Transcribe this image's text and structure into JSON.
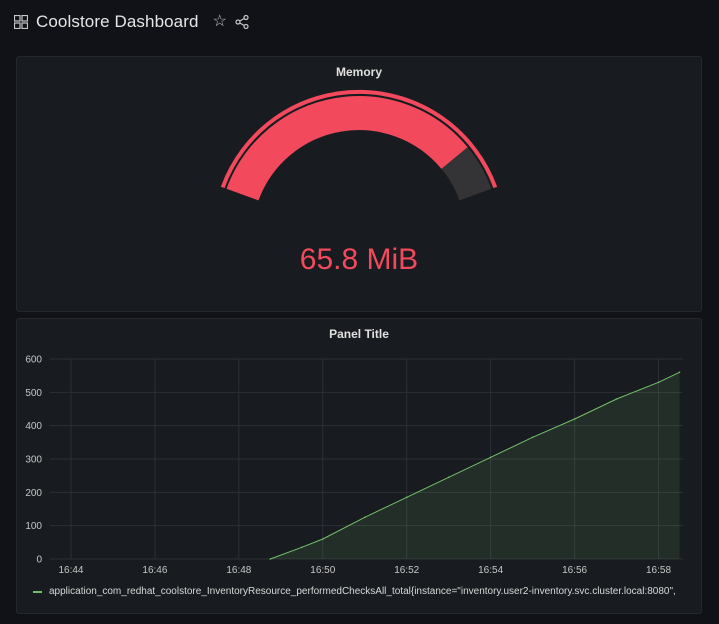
{
  "dashboard": {
    "title": "Coolstore Dashboard"
  },
  "icons": {
    "grid": "dashboard-grid-icon",
    "star": "star-icon",
    "share": "share-icon"
  },
  "colors": {
    "gauge": "#f2495c",
    "series": "#73bf69",
    "background": "#111217",
    "panel": "#181b1f"
  },
  "memory_panel": {
    "title": "Memory",
    "value_text": "65.8 MiB",
    "fill_fraction": 0.86
  },
  "graph_panel": {
    "title": "Panel Title",
    "legend": "application_com_redhat_coolstore_InventoryResource_performedChecksAll_total{instance=\"inventory.user2-inventory.svc.cluster.local:8080\","
  },
  "chart_data": {
    "type": "area",
    "title": "Panel Title",
    "x_ticks": [
      "16:44",
      "16:46",
      "16:48",
      "16:50",
      "16:52",
      "16:54",
      "16:56",
      "16:58"
    ],
    "y_ticks": [
      "0",
      "100",
      "200",
      "300",
      "400",
      "500",
      "600"
    ],
    "ylim": [
      0,
      600
    ],
    "xlim": [
      "16:43:30",
      "16:58:35"
    ],
    "grid": true,
    "legend_position": "bottom-left",
    "series": [
      {
        "name": "application_com_redhat_coolstore_InventoryResource_performedChecksAll_total{instance=\"inventory.user2-inventory.svc.cluster.local:8080\",",
        "color": "#73bf69",
        "x": [
          "16:48:45",
          "16:49:30",
          "16:50:00",
          "16:51:00",
          "16:52:00",
          "16:53:00",
          "16:54:00",
          "16:55:00",
          "16:56:00",
          "16:57:00",
          "16:58:00",
          "16:58:30"
        ],
        "y": [
          0,
          35,
          60,
          125,
          185,
          245,
          305,
          365,
          420,
          480,
          530,
          560
        ]
      }
    ]
  }
}
